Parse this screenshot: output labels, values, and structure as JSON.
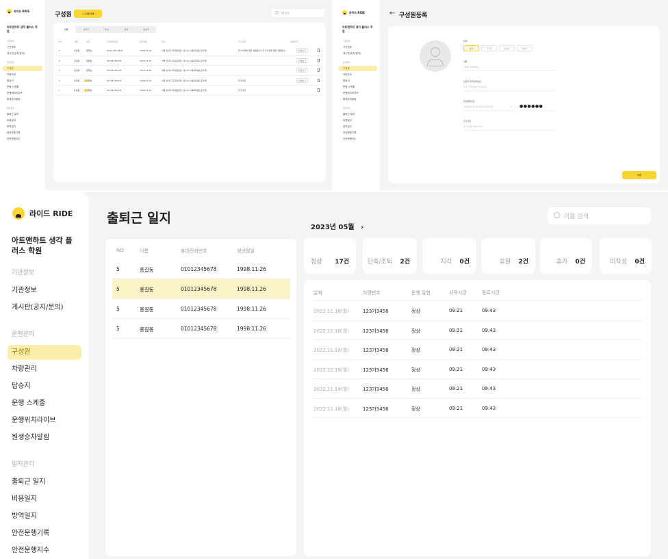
{
  "brand": {
    "name": "라이드 RIDE",
    "mini_name": "라이드 RIDE"
  },
  "org": {
    "name": "아트앤하트 생각 플러스 학원"
  },
  "sidebar": {
    "sections": [
      {
        "title": "기관정보",
        "items": [
          "기관정보",
          "게시판(공지/문의)"
        ]
      },
      {
        "title": "운행관리",
        "items": [
          "구성원",
          "차량관리",
          "탑승지",
          "운행 스케줄",
          "운행위치라이브",
          "원생승차알림"
        ]
      },
      {
        "title": "일지관리",
        "items": [
          "출퇴근 일지",
          "비용일지",
          "방역일지",
          "안전운행기록",
          "안전운행지수"
        ]
      }
    ],
    "active_top": "구성원",
    "active_bottom": "구성원"
  },
  "panel_members": {
    "title": "구성원",
    "add_button": "+ 구성원 등록",
    "search_placeholder": "이름 검색",
    "tabs": [
      "전체",
      "보호자",
      "기사님",
      "원생",
      "동승자"
    ],
    "columns": [
      "NO",
      "이름",
      "유형",
      "휴대전화번호",
      "생년월일",
      "주소",
      "추가사항",
      "연결관계"
    ],
    "rows": [
      {
        "no": "5",
        "name": "홍길동",
        "type": "운행님",
        "phone": "010-1234-5678",
        "birth": "1998.11.26",
        "addr": "서울 강서구 마곡중앙로 1길 24, 4층(마곡동 요지역)",
        "note": "추가사항에 대한 내용입니다 추가사항에 대한 내용입니...",
        "link": "연결보기",
        "dot": false
      },
      {
        "no": "4",
        "name": "홍길동",
        "type": "운행님",
        "phone": "01012345678",
        "birth": "1998.11.26",
        "addr": "서울 강서구 마곡중앙로 1길 24, 4층(마곡동 요지역)",
        "note": "",
        "link": "연결보기",
        "dot": false
      },
      {
        "no": "3",
        "name": "홍길동",
        "type": "운행님",
        "phone": "01012345678",
        "birth": "1998.11.26",
        "addr": "서울 강서구 마곡중앙로 1길 24, 4층(마곡동 요지역)",
        "note": "",
        "link": "연결보기",
        "dot": false
      },
      {
        "no": "2",
        "name": "홍길동",
        "type": "운행님",
        "phone": "01012345678",
        "birth": "1998.11.26",
        "addr": "서울 강서구 마곡중앙로 1길 24, 4층(마곡동 요지역)",
        "note": "추가사항",
        "link": "연결보기",
        "dot": true
      },
      {
        "no": "1",
        "name": "홍길동",
        "type": "운행님",
        "phone": "01012345678",
        "birth": "1998.11.26",
        "addr": "서울 강서구 마곡중앙로 1길 24, 4층(마곡동 요지역)",
        "note": "추가사항",
        "link": "",
        "dot": true
      }
    ]
  },
  "panel_register": {
    "title": "구성원등록",
    "type_label": "유형",
    "types": [
      "원생",
      "기사님",
      "보호자",
      "동승자"
    ],
    "name_label": "이름",
    "name_placeholder": "이름을 입력하세요",
    "phone_label": "보호자 휴대전화번호",
    "phone_placeholder": "휴대 전화번호를 입력하세요",
    "id_label": "주민등록번호",
    "id_placeholder": "주민등록번호 앞자리를 입력하세요",
    "id_masked": "●●●●●●",
    "note_label": "추가사항",
    "note_placeholder": "추가사항을 입력하세요",
    "save_button": "저장"
  },
  "panel_log": {
    "title": "출퇴근 일지",
    "search_placeholder": "이름 검색",
    "month": "2023년 05월",
    "member_columns": [
      "NO",
      "이름",
      "휴대전화번호",
      "생년월일"
    ],
    "members": [
      {
        "no": "5",
        "name": "홍길동",
        "phone": "01012345678",
        "birth": "1998.11.26"
      },
      {
        "no": "5",
        "name": "홍길동",
        "phone": "01012345678",
        "birth": "1998.11.26"
      },
      {
        "no": "5",
        "name": "홍길동",
        "phone": "01012345678",
        "birth": "1998.11.26"
      },
      {
        "no": "5",
        "name": "홍길동",
        "phone": "01012345678",
        "birth": "1998.11.26"
      }
    ],
    "selected_index": 1,
    "stats": [
      {
        "label": "정상",
        "value": "17건"
      },
      {
        "label": "단축/조퇴",
        "value": "2건"
      },
      {
        "label": "지각",
        "value": "0건"
      },
      {
        "label": "휴원",
        "value": "2건"
      },
      {
        "label": "휴가",
        "value": "0건"
      },
      {
        "label": "미작성",
        "value": "0건"
      }
    ],
    "log_columns": [
      "날짜",
      "차량번호",
      "운행 유형",
      "시작시간",
      "종료시간"
    ],
    "logs": [
      {
        "date": "2022.11.18(월)",
        "car": "123가3456",
        "type": "정상",
        "start": "09:21",
        "end": "09:43"
      },
      {
        "date": "2022.11.18(월)",
        "car": "123가3456",
        "type": "정상",
        "start": "09:21",
        "end": "09:43"
      },
      {
        "date": "2022.11.18(월)",
        "car": "123가3456",
        "type": "정상",
        "start": "09:21",
        "end": "09:43"
      },
      {
        "date": "2022.11.18(월)",
        "car": "123가3456",
        "type": "정상",
        "start": "09:21",
        "end": "09:43"
      },
      {
        "date": "2022.11.18(월)",
        "car": "123가3456",
        "type": "정상",
        "start": "09:21",
        "end": "09:43"
      },
      {
        "date": "2022.11.18(월)",
        "car": "123가3456",
        "type": "정상",
        "start": "09:21",
        "end": "09:43"
      }
    ]
  },
  "colors": {
    "accent": "#fcd535",
    "accent_soft": "#fcedaa",
    "bg": "#f3f4f6"
  }
}
